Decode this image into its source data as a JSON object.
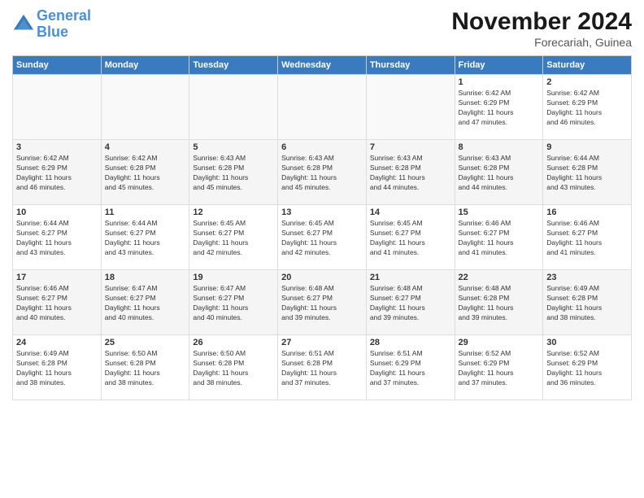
{
  "header": {
    "logo_line1": "General",
    "logo_line2": "Blue",
    "month_title": "November 2024",
    "location": "Forecariah, Guinea"
  },
  "weekdays": [
    "Sunday",
    "Monday",
    "Tuesday",
    "Wednesday",
    "Thursday",
    "Friday",
    "Saturday"
  ],
  "weeks": [
    [
      {
        "day": "",
        "info": ""
      },
      {
        "day": "",
        "info": ""
      },
      {
        "day": "",
        "info": ""
      },
      {
        "day": "",
        "info": ""
      },
      {
        "day": "",
        "info": ""
      },
      {
        "day": "1",
        "info": "Sunrise: 6:42 AM\nSunset: 6:29 PM\nDaylight: 11 hours\nand 47 minutes."
      },
      {
        "day": "2",
        "info": "Sunrise: 6:42 AM\nSunset: 6:29 PM\nDaylight: 11 hours\nand 46 minutes."
      }
    ],
    [
      {
        "day": "3",
        "info": "Sunrise: 6:42 AM\nSunset: 6:29 PM\nDaylight: 11 hours\nand 46 minutes."
      },
      {
        "day": "4",
        "info": "Sunrise: 6:42 AM\nSunset: 6:28 PM\nDaylight: 11 hours\nand 45 minutes."
      },
      {
        "day": "5",
        "info": "Sunrise: 6:43 AM\nSunset: 6:28 PM\nDaylight: 11 hours\nand 45 minutes."
      },
      {
        "day": "6",
        "info": "Sunrise: 6:43 AM\nSunset: 6:28 PM\nDaylight: 11 hours\nand 45 minutes."
      },
      {
        "day": "7",
        "info": "Sunrise: 6:43 AM\nSunset: 6:28 PM\nDaylight: 11 hours\nand 44 minutes."
      },
      {
        "day": "8",
        "info": "Sunrise: 6:43 AM\nSunset: 6:28 PM\nDaylight: 11 hours\nand 44 minutes."
      },
      {
        "day": "9",
        "info": "Sunrise: 6:44 AM\nSunset: 6:28 PM\nDaylight: 11 hours\nand 43 minutes."
      }
    ],
    [
      {
        "day": "10",
        "info": "Sunrise: 6:44 AM\nSunset: 6:27 PM\nDaylight: 11 hours\nand 43 minutes."
      },
      {
        "day": "11",
        "info": "Sunrise: 6:44 AM\nSunset: 6:27 PM\nDaylight: 11 hours\nand 43 minutes."
      },
      {
        "day": "12",
        "info": "Sunrise: 6:45 AM\nSunset: 6:27 PM\nDaylight: 11 hours\nand 42 minutes."
      },
      {
        "day": "13",
        "info": "Sunrise: 6:45 AM\nSunset: 6:27 PM\nDaylight: 11 hours\nand 42 minutes."
      },
      {
        "day": "14",
        "info": "Sunrise: 6:45 AM\nSunset: 6:27 PM\nDaylight: 11 hours\nand 41 minutes."
      },
      {
        "day": "15",
        "info": "Sunrise: 6:46 AM\nSunset: 6:27 PM\nDaylight: 11 hours\nand 41 minutes."
      },
      {
        "day": "16",
        "info": "Sunrise: 6:46 AM\nSunset: 6:27 PM\nDaylight: 11 hours\nand 41 minutes."
      }
    ],
    [
      {
        "day": "17",
        "info": "Sunrise: 6:46 AM\nSunset: 6:27 PM\nDaylight: 11 hours\nand 40 minutes."
      },
      {
        "day": "18",
        "info": "Sunrise: 6:47 AM\nSunset: 6:27 PM\nDaylight: 11 hours\nand 40 minutes."
      },
      {
        "day": "19",
        "info": "Sunrise: 6:47 AM\nSunset: 6:27 PM\nDaylight: 11 hours\nand 40 minutes."
      },
      {
        "day": "20",
        "info": "Sunrise: 6:48 AM\nSunset: 6:27 PM\nDaylight: 11 hours\nand 39 minutes."
      },
      {
        "day": "21",
        "info": "Sunrise: 6:48 AM\nSunset: 6:27 PM\nDaylight: 11 hours\nand 39 minutes."
      },
      {
        "day": "22",
        "info": "Sunrise: 6:48 AM\nSunset: 6:28 PM\nDaylight: 11 hours\nand 39 minutes."
      },
      {
        "day": "23",
        "info": "Sunrise: 6:49 AM\nSunset: 6:28 PM\nDaylight: 11 hours\nand 38 minutes."
      }
    ],
    [
      {
        "day": "24",
        "info": "Sunrise: 6:49 AM\nSunset: 6:28 PM\nDaylight: 11 hours\nand 38 minutes."
      },
      {
        "day": "25",
        "info": "Sunrise: 6:50 AM\nSunset: 6:28 PM\nDaylight: 11 hours\nand 38 minutes."
      },
      {
        "day": "26",
        "info": "Sunrise: 6:50 AM\nSunset: 6:28 PM\nDaylight: 11 hours\nand 38 minutes."
      },
      {
        "day": "27",
        "info": "Sunrise: 6:51 AM\nSunset: 6:28 PM\nDaylight: 11 hours\nand 37 minutes."
      },
      {
        "day": "28",
        "info": "Sunrise: 6:51 AM\nSunset: 6:29 PM\nDaylight: 11 hours\nand 37 minutes."
      },
      {
        "day": "29",
        "info": "Sunrise: 6:52 AM\nSunset: 6:29 PM\nDaylight: 11 hours\nand 37 minutes."
      },
      {
        "day": "30",
        "info": "Sunrise: 6:52 AM\nSunset: 6:29 PM\nDaylight: 11 hours\nand 36 minutes."
      }
    ]
  ]
}
